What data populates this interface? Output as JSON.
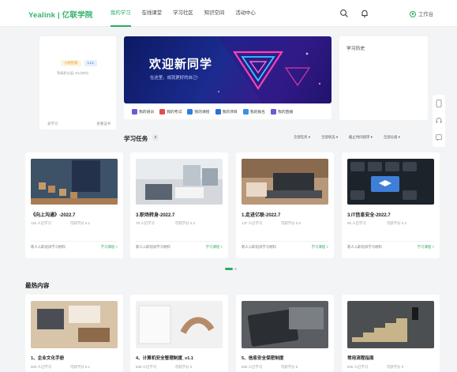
{
  "header": {
    "logo": "Yealink | 亿联学院",
    "nav": [
      "我的学习",
      "在线课堂",
      "学习社区",
      "知识空间",
      "活动中心"
    ],
    "workspace": "工作台"
  },
  "profile": {
    "badge_a": "小视觉家",
    "badge_b": "Lv.1",
    "sub": "等级积分值: 8/L(50/0)",
    "link_left": "去学习",
    "link_right": "查看证书"
  },
  "banner": {
    "title": "欢迎新同学",
    "subtitle": "在这里，成就更好的自己!"
  },
  "quick_links": [
    {
      "label": "我的培训",
      "color": "#6b5bd6"
    },
    {
      "label": "我的考试",
      "color": "#e24e4e"
    },
    {
      "label": "我的课程",
      "color": "#2f7ee6"
    },
    {
      "label": "我的项目",
      "color": "#2f6fd6"
    },
    {
      "label": "我的报名",
      "color": "#3f8de6"
    },
    {
      "label": "我的直播",
      "color": "#6b5bd6"
    }
  ],
  "history": {
    "title": "学习历史"
  },
  "tasks": {
    "title": "学习任务",
    "count": "8",
    "filters": [
      "全部任务",
      "全部状态",
      "截止时间排序",
      "全部分类"
    ],
    "items": [
      {
        "title": "《向上沟通》-2022.7",
        "learners": "115 人已学习",
        "score": "可获学分 0.2",
        "foot": "新人入职培训学习材料",
        "link": "学习课程 >"
      },
      {
        "title": "3.职场转身-2022.7",
        "learners": "78 人已学习",
        "score": "可获学分 0.2",
        "foot": "新人入职培训学习材料",
        "link": "学习课程 >"
      },
      {
        "title": "1.走进亿联-2022.7",
        "learners": "137 人已学习",
        "score": "可获学分 0.5",
        "foot": "新人入职培训学习材料",
        "link": "学习课程 >"
      },
      {
        "title": "3.IT信息安全-2022.7",
        "learners": "96 人已学习",
        "score": "可获学分 0.4",
        "foot": "新人入职培训学习材料",
        "link": "学习课程 >"
      }
    ]
  },
  "hot": {
    "title": "最热内容",
    "items": [
      {
        "title": "1、企业文化手册",
        "learners": "500 人已学习",
        "score": "可获学分 0.1"
      },
      {
        "title": "4、计算机安全管理制度_v1.1",
        "learners": "509 人已学习",
        "score": "可获学分 0"
      },
      {
        "title": "5、信息安全保密制度",
        "learners": "508 人已学习",
        "score": "可获学分 0"
      },
      {
        "title": "常用流程指南",
        "learners": "505 人已学习",
        "score": "可获学分 0"
      }
    ]
  },
  "colors": {
    "accent": "#2bab63",
    "banner": "#1b2b8f"
  }
}
